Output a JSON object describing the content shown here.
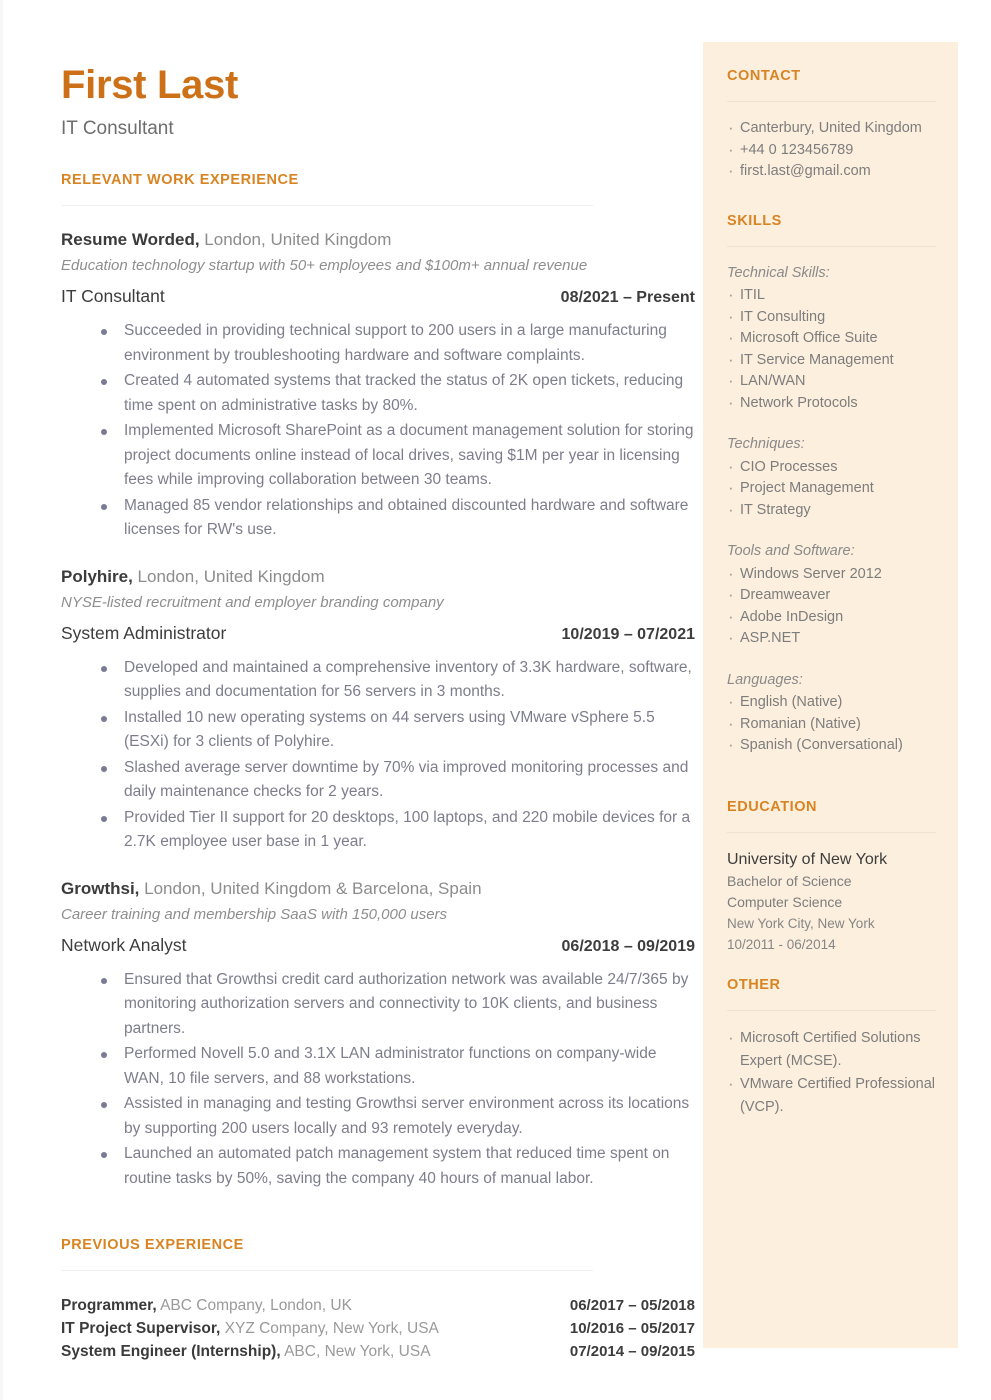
{
  "header": {
    "name": "First Last",
    "role": "IT Consultant"
  },
  "main": {
    "work_heading": "RELEVANT WORK EXPERIENCE",
    "previous_heading": "PREVIOUS EXPERIENCE",
    "jobs": [
      {
        "company": "Resume Worded,",
        "location": " London, United Kingdom",
        "description": "Education technology startup with 50+ employees and $100m+ annual revenue",
        "title": "IT Consultant",
        "dates": "08/2021 – Present",
        "bullets": [
          "Succeeded in providing technical support to 200 users in a large manufacturing environment by troubleshooting hardware and software complaints.",
          "Created 4 automated systems that tracked the status of 2K open tickets, reducing time spent on administrative tasks by 80%.",
          "Implemented Microsoft SharePoint as a document management solution for storing project documents online instead of local drives, saving $1M per year in licensing fees while improving collaboration between 30 teams.",
          "Managed 85 vendor relationships and obtained discounted hardware and software licenses for RW's use."
        ]
      },
      {
        "company": "Polyhire,",
        "location": " London, United Kingdom",
        "description": "NYSE-listed recruitment and employer branding company",
        "title": "System Administrator",
        "dates": "10/2019 – 07/2021",
        "bullets": [
          "Developed and maintained a comprehensive inventory of 3.3K hardware, software, supplies and documentation for 56 servers in 3 months.",
          "Installed 10 new operating systems on 44 servers using VMware vSphere 5.5 (ESXi) for 3 clients of Polyhire.",
          "Slashed average server downtime by 70% via improved monitoring processes and daily maintenance checks for 2 years.",
          "Provided Tier II support for 20 desktops, 100 laptops, and 220 mobile devices for a 2.7K employee user base in 1 year."
        ]
      },
      {
        "company": "Growthsi,",
        "location": " London, United Kingdom & Barcelona, Spain",
        "description": "Career training and membership SaaS with 150,000 users",
        "title": "Network Analyst",
        "dates": "06/2018 – 09/2019",
        "bullets": [
          "Ensured that Growthsi credit card authorization network was available 24/7/365 by monitoring authorization servers and connectivity to 10K clients, and business partners.",
          "Performed Novell 5.0 and 3.1X LAN administrator functions on company-wide WAN, 10 file servers, and 88 workstations.",
          "Assisted in managing and testing Growthsi server environment across its locations by supporting 200 users locally and 93 remotely everyday.",
          "Launched an automated patch management system that reduced time spent on routine tasks by 50%, saving the company 40 hours of manual labor."
        ]
      }
    ],
    "previous_jobs": [
      {
        "title": "Programmer,",
        "detail": " ABC Company, London, UK",
        "dates": "06/2017 – 05/2018"
      },
      {
        "title": "IT Project Supervisor,",
        "detail": " XYZ Company, New York, USA",
        "dates": "10/2016 – 05/2017"
      },
      {
        "title": "System Engineer (Internship),",
        "detail": " ABC, New York, USA",
        "dates": "07/2014 – 09/2015"
      }
    ]
  },
  "sidebar": {
    "contact": {
      "heading": "CONTACT",
      "items": [
        "Canterbury, United Kingdom",
        "+44 0 123456789",
        "first.last@gmail.com"
      ]
    },
    "skills": {
      "heading": "SKILLS",
      "groups": [
        {
          "label": "Technical Skills:",
          "items": [
            "ITIL",
            "IT Consulting",
            "Microsoft Office Suite",
            "IT Service Management",
            "LAN/WAN",
            "Network Protocols"
          ]
        },
        {
          "label": "Techniques:",
          "items": [
            "CIO Processes",
            "Project Management",
            "IT Strategy"
          ]
        },
        {
          "label": "Tools and Software:",
          "items": [
            "Windows Server 2012",
            "Dreamweaver",
            "Adobe InDesign",
            "ASP.NET"
          ]
        },
        {
          "label": "Languages:",
          "items": [
            "English (Native)",
            "Romanian (Native)",
            "Spanish (Conversational)"
          ]
        }
      ]
    },
    "education": {
      "heading": "EDUCATION",
      "school": "University of New York",
      "degree": "Bachelor of Science",
      "field": "Computer Science",
      "location": "New York City, New York",
      "dates": "10/2011 - 06/2014"
    },
    "other": {
      "heading": "OTHER",
      "items": [
        "Microsoft Certified Solutions Expert (MCSE).",
        "VMware Certified Professional (VCP)."
      ]
    }
  },
  "colors": {
    "accent": "#d98422",
    "name": "#cd7118",
    "sidebar_bg": "#fcefde",
    "bullet": "#7a7a96"
  }
}
